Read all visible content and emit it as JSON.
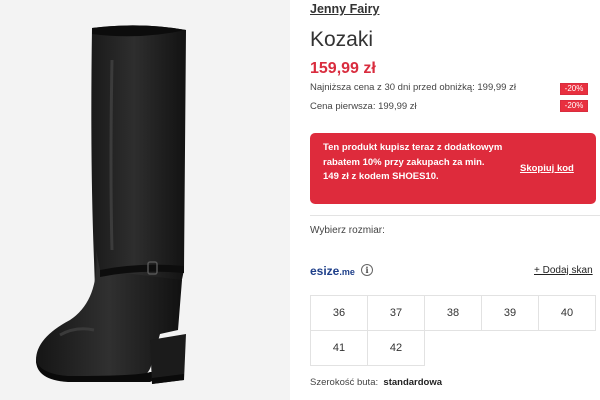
{
  "product": {
    "brand": "Jenny Fairy",
    "title": "Kozaki",
    "price": "159,99 zł",
    "lowest_price_label": "Najniższa cena z 30 dni przed obniżką: 199,99 zł",
    "lowest_price_badge": "-20%",
    "first_price_label": "Cena pierwsza: 199,99 zł",
    "first_price_badge": "-20%"
  },
  "promo": {
    "text": "Ten produkt kupisz teraz z dodatkowym rabatem 10% przy zakupach za min. 149 zł z kodem SHOES10.",
    "copy_label": "Skopiuj kod"
  },
  "size_select": {
    "label": "Wybierz rozmiar:",
    "esize_brand": "esize",
    "esize_suffix": ".me",
    "info_icon": "i",
    "add_scan_label": "+ Dodaj skan",
    "sizes": [
      "36",
      "37",
      "38",
      "39",
      "40",
      "41",
      "42"
    ]
  },
  "width": {
    "label": "Szerokość buta:",
    "value": "standardowa"
  },
  "colors": {
    "accent_red": "#de2b3c",
    "esize_blue": "#1e3f8a",
    "image_bg": "#f3f3f3"
  },
  "icons": {
    "info": "info-icon"
  }
}
